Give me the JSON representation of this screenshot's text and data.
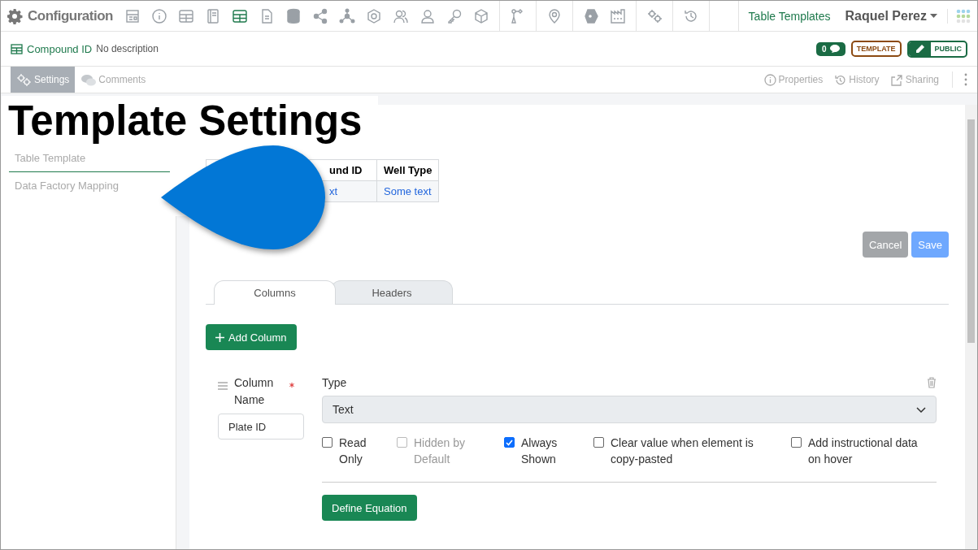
{
  "app": {
    "title": "Configuration",
    "section": "Table Templates",
    "user": "Raquel Perez"
  },
  "nav_groups": [
    [
      {
        "selected": false
      },
      {
        "selected": false
      },
      {
        "selected": false
      },
      {
        "selected": false
      },
      {
        "selected": true
      },
      {
        "selected": false
      },
      {
        "selected": false
      },
      {
        "selected": false
      },
      {
        "selected": false
      },
      {
        "selected": false
      },
      {
        "selected": false
      },
      {
        "selected": false
      },
      {
        "selected": false
      },
      {
        "selected": false
      }
    ],
    [
      {
        "selected": false
      }
    ],
    [
      {
        "selected": false
      }
    ],
    [
      {
        "selected": false
      },
      {
        "selected": false
      }
    ],
    [
      {
        "selected": false
      }
    ],
    [
      {
        "selected": false
      }
    ]
  ],
  "record": {
    "name": "Compound ID",
    "description": "No description",
    "comment_count": "0",
    "type_badge": "TEMPLATE",
    "visibility": "PUBLIC"
  },
  "view_tabs": [
    {
      "label": "Settings",
      "selected": true
    },
    {
      "label": "Comments",
      "selected": false
    }
  ],
  "actions": [
    "Properties",
    "History",
    "Sharing"
  ],
  "heading": "Template Settings",
  "sidebar": {
    "items": [
      {
        "label": "Table Template",
        "selected": true
      },
      {
        "label": "Data Factory Mapping",
        "selected": false
      }
    ]
  },
  "preview_table": {
    "columns": [
      "und ID",
      "Well Type"
    ],
    "rows": [
      [
        "xt",
        "Some text"
      ]
    ]
  },
  "buttons": {
    "cancel": "Cancel",
    "save": "Save"
  },
  "tabs": [
    {
      "label": "Columns",
      "selected": true
    },
    {
      "label": "Headers",
      "selected": false
    }
  ],
  "add_column": "Add Column",
  "column": {
    "name_label": "Column Name",
    "name_value": "Plate ID",
    "type_label": "Type",
    "type_value": "Text",
    "options": [
      {
        "label": "Read Only",
        "checked": false,
        "disabled": false
      },
      {
        "label": "Hidden by Default",
        "checked": false,
        "disabled": true
      },
      {
        "label": "Always Shown",
        "checked": true,
        "disabled": false
      },
      {
        "label": "Clear value when element is copy-pasted",
        "checked": false,
        "disabled": false
      },
      {
        "label": "Add instructional data on hover",
        "checked": false,
        "disabled": false
      }
    ],
    "equation_button": "Define Equation"
  }
}
